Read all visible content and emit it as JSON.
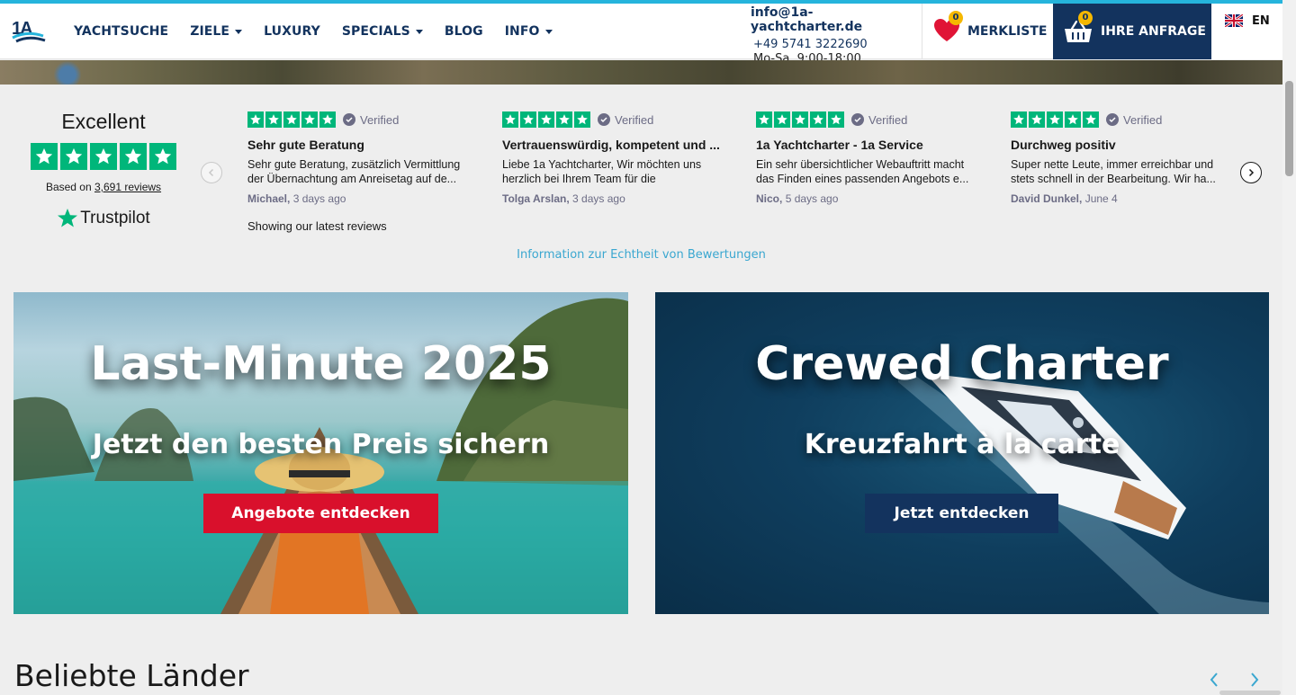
{
  "colors": {
    "brand_navy": "#13335e",
    "accent_cyan": "#25b4dc",
    "trustpilot_green": "#00b67a",
    "badge_yellow": "#f5b800",
    "cta_red": "#d9102c",
    "heart_red": "#e01436"
  },
  "header": {
    "logo_alt": "1A",
    "nav": [
      {
        "label": "YACHTSUCHE",
        "dropdown": false,
        "icon": ""
      },
      {
        "label": "ZIELE",
        "dropdown": true,
        "icon": "chevron-down-icon"
      },
      {
        "label": "LUXURY",
        "dropdown": false,
        "icon": ""
      },
      {
        "label": "SPECIALS",
        "dropdown": true,
        "icon": "chevron-down-icon"
      },
      {
        "label": "BLOG",
        "dropdown": false,
        "icon": ""
      },
      {
        "label": "INFO",
        "dropdown": true,
        "icon": "chevron-down-icon"
      }
    ],
    "contact": {
      "email": "info@1a-yachtcharter.de",
      "phone": "+49 5741 3222690",
      "hours": "Mo-Sa, 9:00-18:00"
    },
    "wishlist": {
      "label": "MERKLISTE",
      "count": "0",
      "icon": "heart-icon"
    },
    "inquiry": {
      "label": "IHRE ANFRAGE",
      "count": "0",
      "icon": "basket-icon"
    },
    "language": {
      "code": "EN",
      "icon": "uk-flag-icon"
    }
  },
  "trustpilot": {
    "rating_word": "Excellent",
    "based_on_prefix": "Based on",
    "review_count": "3,691 reviews",
    "brand": "Trustpilot",
    "showing": "Showing our latest reviews",
    "info_link": "Information zur Echtheit von Bewertungen",
    "verified_label": "Verified",
    "reviews": [
      {
        "title": "Sehr gute Beratung",
        "text": "Sehr gute Beratung, zusätzlich Vermittlung der Übernachtung am Anreisetag auf de...",
        "author": "Michael,",
        "date": "3 days ago"
      },
      {
        "title": "Vertrauenswürdig, kompetent und ...",
        "text": "Liebe 1a Yachtcharter, Wir möchten uns herzlich bei Ihrem Team für die",
        "author": "Tolga Arslan,",
        "date": "3 days ago"
      },
      {
        "title": "1a Yachtcharter - 1a Service",
        "text": "Ein sehr übersichtlicher Webauftritt macht das Finden eines passenden Angebots e...",
        "author": "Nico,",
        "date": "5 days ago"
      },
      {
        "title": "Durchweg positiv",
        "text": "Super nette Leute, immer erreichbar und stets schnell in der Bearbeitung. Wir ha...",
        "author": "David Dunkel,",
        "date": "June 4"
      }
    ]
  },
  "promos": [
    {
      "title": "Last-Minute 2025",
      "subtitle": "Jetzt den besten Preis sichern",
      "cta": "Angebote entdecken"
    },
    {
      "title": "Crewed Charter",
      "subtitle": "Kreuzfahrt à la carte",
      "cta": "Jetzt entdecken"
    }
  ],
  "popular_countries": {
    "title": "Beliebte Länder"
  }
}
